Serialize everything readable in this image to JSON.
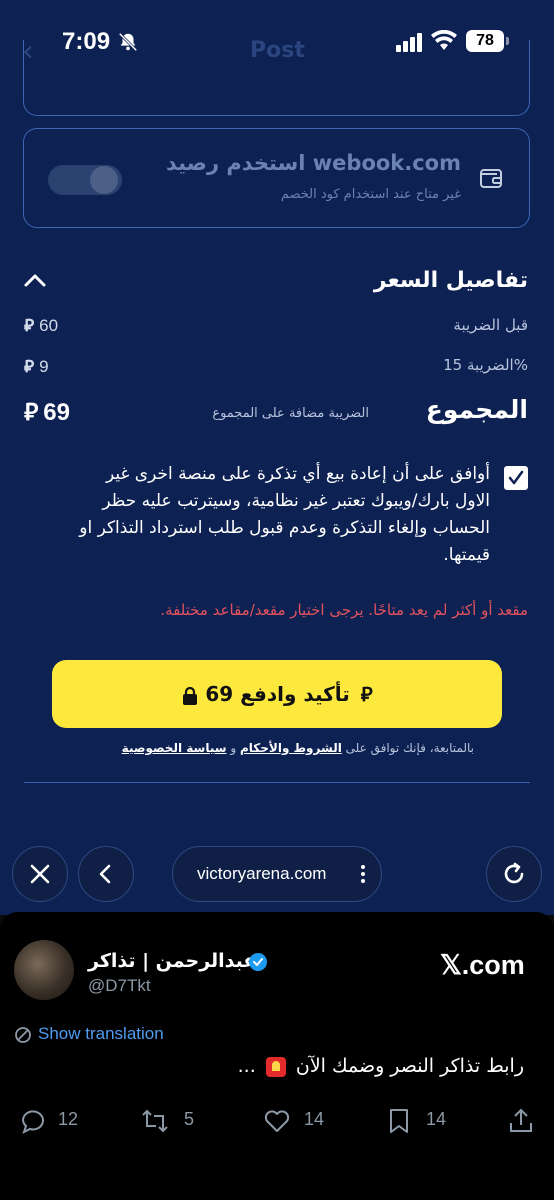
{
  "status_bar": {
    "time": "7:09",
    "battery": "78",
    "ghost_title": "Post"
  },
  "wallet": {
    "title": "استخدم رصيد webook.com",
    "subtitle": "غير متاح عند استخدام كود الخصم",
    "toggle_on": false
  },
  "price_details": {
    "heading": "تفاصيل السعر",
    "before_tax_label": "قبل الضريبة",
    "before_tax_value": "60",
    "tax_label": "الضريبة 15%",
    "tax_value": "9",
    "total_label": "المجموع",
    "total_note": "الضريبة مضافة على المجموع",
    "total_value": "69",
    "currency_symbol": "⃁"
  },
  "agreement": {
    "checked": true,
    "text": "أوافق على أن إعادة بيع أي تذكرة على منصة اخرى غير الاول بارك/ويبوك تعتبر غير نظامية، وسيترتب عليه حظر الحساب وإلغاء التذكرة وعدم قبول طلب استرداد التذاكر او قيمتها."
  },
  "error_message": "مقعد أو أكثر لم يعد متاحًا. يرجى اختيار مقعد/مقاعد مختلفة.",
  "pay_button": {
    "label": "تأكيد وادفع",
    "amount": "69"
  },
  "terms": {
    "prefix": "بالمتابعة، فإنك توافق على",
    "terms_link": "الشروط والأحكام",
    "and": "و",
    "privacy_link": "سياسة الخصوصية"
  },
  "browser": {
    "url": "victoryarena.com"
  },
  "tweet": {
    "name": "عبدالرحمن | تذاكر",
    "handle": "@D7Tkt",
    "source": "𝕏.com",
    "show_translation": "Show translation",
    "text_before": "رابط تذاكر النصر وضمك الآن",
    "text_after": "...",
    "replies": "12",
    "reposts": "5",
    "likes": "14",
    "bookmarks": "14"
  },
  "colors": {
    "page_bg": "#0d2152",
    "border": "#3a66b8",
    "button_yellow": "#fde93d",
    "error_red": "#e3535e",
    "link_blue": "#4f9cf2"
  }
}
